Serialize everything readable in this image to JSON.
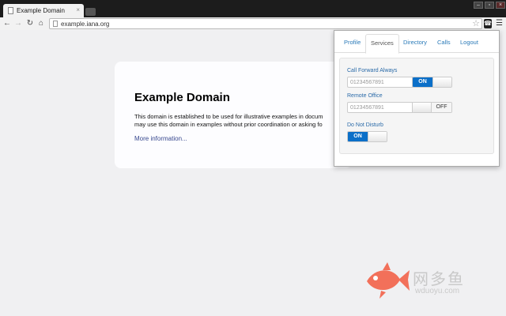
{
  "browser": {
    "tab_title": "Example Domain",
    "tab_close": "×",
    "url": "example.iana.org",
    "window_controls": {
      "minimize": "–",
      "restore": "▫",
      "close": "×"
    },
    "nav_icons": {
      "back": "back-arrow-icon",
      "forward": "forward-arrow-icon",
      "reload": "reload-icon",
      "home": "home-icon"
    },
    "ext_icon": "phone-extension-icon",
    "menu_icon": "hamburger-menu-icon"
  },
  "page": {
    "title": "Example Domain",
    "para_line1": "This domain is established to be used for illustrative examples in docum",
    "para_line2": "may use this domain in examples without prior coordination or asking fo",
    "link": "More information..."
  },
  "popup": {
    "tabs": [
      "Profile",
      "Services",
      "Directory",
      "Calls",
      "Logout"
    ],
    "active_tab": "Services",
    "services": {
      "call_forward": {
        "label": "Call Forward Always",
        "placeholder": "01234567891",
        "state": "ON"
      },
      "remote_office": {
        "label": "Remote Office",
        "placeholder": "01234567891",
        "state": "OFF"
      },
      "dnd": {
        "label": "Do Not Disturb",
        "state": "ON"
      }
    }
  },
  "watermark": {
    "cn": "网多鱼",
    "en": "wduoyu.com"
  },
  "colors": {
    "accent": "#0b6fc8",
    "link": "#2a7ab8",
    "watermark_fish": "#f2705a"
  }
}
